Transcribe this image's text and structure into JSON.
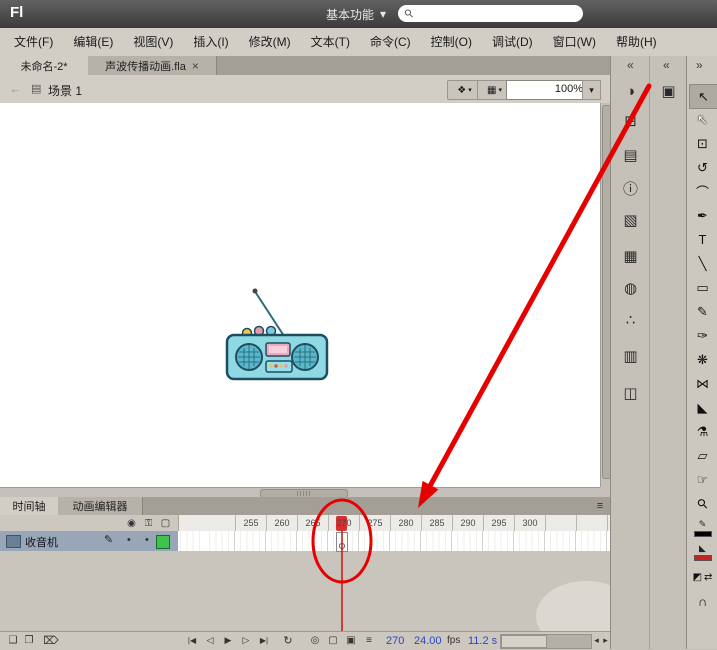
{
  "titlebar": {
    "logo": "Fl",
    "workspace": "基本功能",
    "dropdown_arrow": "▾",
    "search_icon": "⚲"
  },
  "menubar": {
    "items": [
      "文件(F)",
      "编辑(E)",
      "视图(V)",
      "插入(I)",
      "修改(M)",
      "文本(T)",
      "命令(C)",
      "控制(O)",
      "调试(D)",
      "窗口(W)",
      "帮助(H)"
    ]
  },
  "tabbar": {
    "doc1": "未命名-2*",
    "doc2": "声波传播动画.fla",
    "close_icon": "×"
  },
  "editbar": {
    "back_icon": "←",
    "scene_icon": "▤",
    "scene_label": "场景 1",
    "edit_scene_icon": "❖",
    "edit_symbol_icon": "▦",
    "dropdown_arrow": "▾",
    "zoom_value": "100%"
  },
  "timeline": {
    "tab_timeline": "时间轴",
    "tab_motion_editor": "动画编辑器",
    "panel_menu_icon": "≡",
    "eye_icon": "◉",
    "lock_icon": "⚿",
    "outline_icon": "▢",
    "ruler": [
      "255",
      "260",
      "265",
      "270",
      "275",
      "280",
      "285",
      "290",
      "295",
      "300"
    ],
    "layer_name": "收音机",
    "pencil_icon": "✎",
    "dot_icon": "•",
    "new_layer_icon": "❑",
    "new_folder_icon": "❒",
    "delete_icon": "⌦",
    "first_frame_icon": "|◀",
    "prev_frame_icon": "◁",
    "play_icon": "▶",
    "next_frame_icon": "▷",
    "last_frame_icon": "▶|",
    "loop_icon": "↻",
    "center_frame_icon": "◎",
    "onion_skin_icon": "▢",
    "onion_outline_icon": "▣",
    "edit_multiple_icon": "≡",
    "current_frame": "270",
    "fps_value": "24.00",
    "fps_unit": "fps",
    "elapsed_time": "11.2 s",
    "scroll_left_icon": "◂",
    "scroll_right_icon": "▸"
  },
  "dock": {
    "collapse_icon": "«",
    "collapse_icon2": "«",
    "tools_collapse_icon": "»",
    "top_panel_glyph": "▣",
    "panels": [
      {
        "name": "color",
        "glyph": "◑"
      },
      {
        "name": "swatches",
        "glyph": "⊞"
      },
      {
        "name": "align",
        "glyph": "▤"
      },
      {
        "name": "info",
        "glyph": "ⓘ"
      },
      {
        "name": "transform",
        "glyph": "▧"
      },
      {
        "name": "code-snippets",
        "glyph": "▦"
      },
      {
        "name": "motion-presets",
        "glyph": "◍"
      },
      {
        "name": "history",
        "glyph": "∴"
      },
      {
        "name": "library",
        "glyph": "▥"
      },
      {
        "name": "strings",
        "glyph": "◫"
      }
    ]
  },
  "tools": [
    {
      "name": "selection",
      "glyph": "↖"
    },
    {
      "name": "subselection",
      "glyph": "↖"
    },
    {
      "name": "free-transform",
      "glyph": "⊡"
    },
    {
      "name": "3d-rotation",
      "glyph": "↺"
    },
    {
      "name": "lasso",
      "glyph": "⌒"
    },
    {
      "name": "pen",
      "glyph": "✒"
    },
    {
      "name": "text",
      "glyph": "T"
    },
    {
      "name": "line",
      "glyph": "╲"
    },
    {
      "name": "rectangle",
      "glyph": "▭"
    },
    {
      "name": "pencil",
      "glyph": "✎"
    },
    {
      "name": "brush",
      "glyph": "✑"
    },
    {
      "name": "deco",
      "glyph": "❋"
    },
    {
      "name": "bone",
      "glyph": "⋈"
    },
    {
      "name": "paint-bucket",
      "glyph": "◣"
    },
    {
      "name": "eyedropper",
      "glyph": "⚗"
    },
    {
      "name": "eraser",
      "glyph": "▱"
    },
    {
      "name": "hand",
      "glyph": "☞"
    },
    {
      "name": "zoom",
      "glyph": "⚲"
    }
  ],
  "toolbar_extras": {
    "bw_icon": "◩",
    "swap_icon": "⇄",
    "magnet_icon": "∩"
  },
  "colors": {
    "annotation_red": "#e60000",
    "playhead_red": "#cc1111",
    "layer_active_green": "#3fc24e"
  }
}
